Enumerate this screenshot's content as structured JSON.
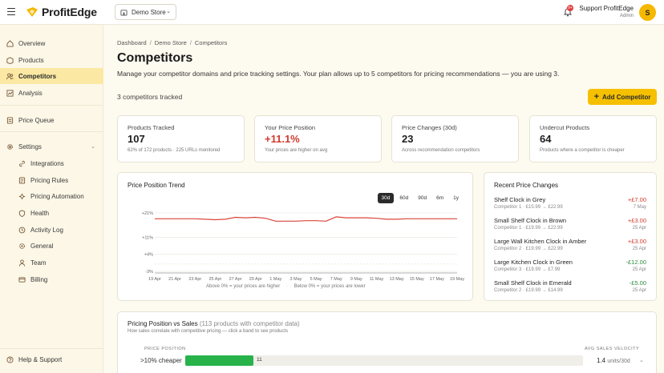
{
  "topbar": {
    "brand": "ProfitEdge",
    "store": "Demo Store",
    "notification_count": "9+",
    "user_name": "Support ProfitEdge",
    "user_role": "Admin",
    "avatar_initial": "S"
  },
  "sidebar": {
    "items": [
      {
        "label": "Overview",
        "icon": "home-icon"
      },
      {
        "label": "Products",
        "icon": "box-icon"
      },
      {
        "label": "Competitors",
        "icon": "users-icon"
      },
      {
        "label": "Analysis",
        "icon": "chart-icon"
      },
      {
        "label": "Price Queue",
        "icon": "list-icon"
      },
      {
        "label": "Settings",
        "icon": "gear-icon"
      },
      {
        "label": "Integrations",
        "icon": "link-icon"
      },
      {
        "label": "Pricing Rules",
        "icon": "rules-icon"
      },
      {
        "label": "Pricing Automation",
        "icon": "automation-icon"
      },
      {
        "label": "Health",
        "icon": "shield-icon"
      },
      {
        "label": "Activity Log",
        "icon": "clock-icon"
      },
      {
        "label": "General",
        "icon": "sliders-icon"
      },
      {
        "label": "Team",
        "icon": "team-icon"
      },
      {
        "label": "Billing",
        "icon": "card-icon"
      }
    ],
    "help": "Help & Support"
  },
  "page": {
    "breadcrumb": [
      "Dashboard",
      "Demo Store",
      "Competitors"
    ],
    "title": "Competitors",
    "subtitle": "Manage your competitor domains and price tracking settings. Your plan allows up to 5 competitors for pricing recommendations — you are using 3.",
    "tracked": "3 competitors tracked",
    "add_button": "Add Competitor"
  },
  "stats": [
    {
      "label": "Products Tracked",
      "value": "107",
      "sub": "62% of 172 products · 225 URLs monitored"
    },
    {
      "label": "Your Price Position",
      "value": "+11.1%",
      "sub": "Your prices are higher on avg"
    },
    {
      "label": "Price Changes (30d)",
      "value": "23",
      "sub": "Across recommendation competitors"
    },
    {
      "label": "Undercut Products",
      "value": "64",
      "sub": "Products where a competitor is cheaper"
    }
  ],
  "trend": {
    "title": "Price Position Trend",
    "ranges": [
      "30d",
      "60d",
      "90d",
      "6m",
      "1y"
    ],
    "active_range": "30d",
    "legend_above": "Above 0% = your prices are higher",
    "legend_below": "Below 0% = your prices are lower",
    "line_color": "#d9463a"
  },
  "chart_data": {
    "type": "line",
    "title": "Price Position Trend",
    "y_ticks": [
      "+21%",
      "+11%",
      "+4%",
      "-3%"
    ],
    "ylim": [
      -3,
      21
    ],
    "x": [
      "19 Apr",
      "20 Apr",
      "21 Apr",
      "22 Apr",
      "23 Apr",
      "24 Apr",
      "25 Apr",
      "26 Apr",
      "27 Apr",
      "28 Apr",
      "29 Apr",
      "30 Apr",
      "1 May",
      "2 May",
      "3 May",
      "4 May",
      "5 May",
      "6 May",
      "7 May",
      "8 May",
      "9 May",
      "10 May",
      "11 May",
      "12 May",
      "13 May",
      "14 May",
      "15 May",
      "16 May",
      "17 May",
      "18 May",
      "19 May"
    ],
    "x_tick_labels": [
      "19 Apr",
      "21 Apr",
      "23 Apr",
      "25 Apr",
      "27 Apr",
      "29 Apr",
      "1 May",
      "3 May",
      "5 May",
      "7 May",
      "9 May",
      "11 May",
      "13 May",
      "15 May",
      "17 May",
      "19 May"
    ],
    "series": [
      {
        "values": [
          18.6,
          18.6,
          18.6,
          18.6,
          18.6,
          18.4,
          18.2,
          18.4,
          19.2,
          19.0,
          19.2,
          18.8,
          17.6,
          17.6,
          17.6,
          17.8,
          17.8,
          17.6,
          19.4,
          19.0,
          19.0,
          19.0,
          18.8,
          18.4,
          18.4,
          18.6,
          18.6,
          18.6,
          18.6,
          18.6,
          18.6
        ]
      }
    ]
  },
  "recent": {
    "title": "Recent Price Changes",
    "items": [
      {
        "name": "Shelf Clock in Grey",
        "detail": "Competitor 1 · £15.99 → £22.99",
        "change": "+£7.00",
        "dir": "up",
        "date": "7 May"
      },
      {
        "name": "Small Shelf Clock in Brown",
        "detail": "Competitor 1 · £19.99 → £22.99",
        "change": "+£3.00",
        "dir": "up",
        "date": "25 Apr"
      },
      {
        "name": "Large Wall Kitchen Clock in Amber",
        "detail": "Competitor 2 · £19.99 → £22.99",
        "change": "+£3.00",
        "dir": "up",
        "date": "25 Apr"
      },
      {
        "name": "Large Kitchen Clock in Green",
        "detail": "Competitor 3 · £19.99 → £7.99",
        "change": "-£12.00",
        "dir": "down",
        "date": "25 Apr"
      },
      {
        "name": "Small Shelf Clock in Emerald",
        "detail": "Competitor 2 · £19.99 → £14.99",
        "change": "-£5.00",
        "dir": "down",
        "date": "25 Apr"
      }
    ]
  },
  "position_sales": {
    "title": "Pricing Position vs Sales",
    "title_note": "(113 products with competitor data)",
    "subtitle": "How sales correlate with competitive pricing — click a band to see products",
    "col_left": "PRICE POSITION",
    "col_right": "AVG SALES VELOCITY",
    "rows": [
      {
        "label": ">10% cheaper",
        "count": "11",
        "share": 0.171,
        "velocity": "1.4",
        "unit": "units/30d"
      }
    ]
  }
}
